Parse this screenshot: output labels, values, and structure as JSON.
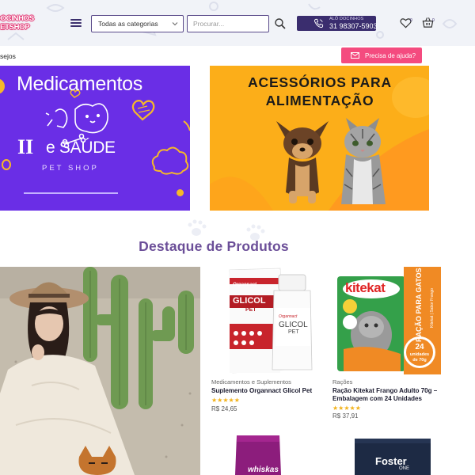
{
  "header": {
    "logo_line1": "DOCINHOS",
    "logo_line2": "PETSHOP",
    "category_select": "Todas as categorias",
    "search_placeholder": "Procurar...",
    "phone_label": "ALÔ DOCINHOS",
    "phone_number": "31 98307-5903",
    "wishlist_count": "0",
    "cart_count": "0",
    "colors": {
      "header_bg": "#f1f3f8",
      "brand_purple": "#3a2d6e",
      "accent_pink": "#f44b7f"
    }
  },
  "subbar": {
    "breadcrumb": "sejos",
    "help_button": "Precisa de ajuda?"
  },
  "banners": [
    {
      "title": "Medicamentos",
      "subtitle": "e SAÚDE",
      "ii": "II",
      "tagline": "PET SHOP",
      "bg": "#6a2ee6"
    },
    {
      "title_line1": "ACESSÓRIOS PARA",
      "title_line2": "ALIMENTAÇÃO",
      "bg": "#fcae19"
    }
  ],
  "section": {
    "title": "Destaque de Produtos"
  },
  "products": [
    {
      "category": "Medicamentos e Suplementos",
      "name": "Suplemento Organnact Glicol Pet",
      "stars": "★★★★★",
      "price": "R$ 24,65",
      "box_brand": "Organnact",
      "box_label_1": "GLICOL",
      "box_label_2": "PET"
    },
    {
      "category": "Rações",
      "name": "Ração Kitekat Frango Adulto 70g – Embalagem com 24 Unidades",
      "stars": "★★★★★",
      "price": "R$ 37,91",
      "brand": "kitekat",
      "side_text": "RAÇÃO PARA GATOS",
      "side_sub": "Kitekat | Sabor Frango",
      "units": "24",
      "units_label": "unidades",
      "units_size": "de 70g"
    },
    {
      "brand": "whiskas"
    },
    {
      "brand": "Foster",
      "sub": "ONE"
    }
  ]
}
